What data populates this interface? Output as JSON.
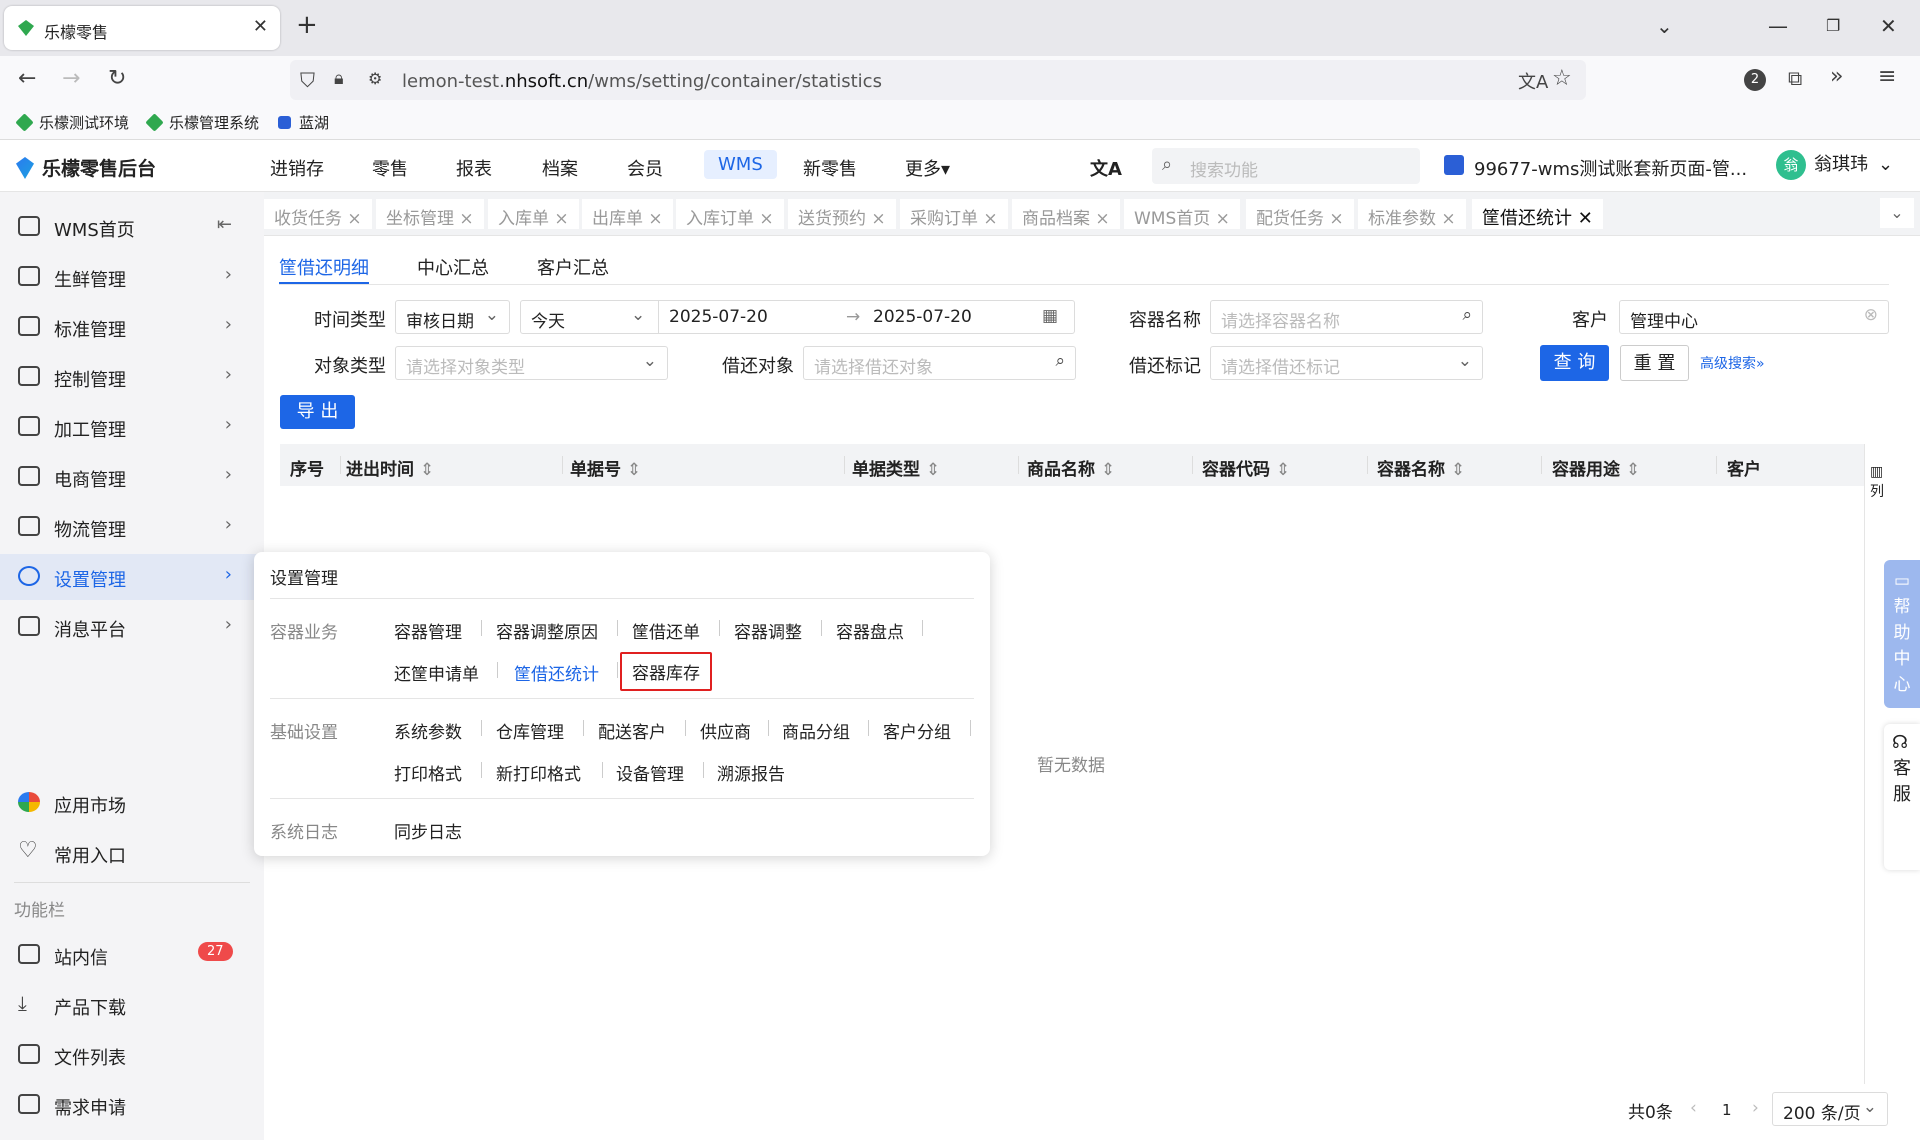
{
  "browser": {
    "tab_title": "乐檬零售",
    "url_prefix": "lemon-test.",
    "url_domain": "nhsoft.cn",
    "url_path": "/wms/setting/container/statistics",
    "ext_badge": "2",
    "bookmarks": [
      "乐檬测试环境",
      "乐檬管理系统",
      "蓝湖"
    ]
  },
  "header": {
    "logo": "乐檬零售后台",
    "nav": [
      "进销存",
      "零售",
      "报表",
      "档案",
      "会员",
      "WMS",
      "新零售",
      "更多▾"
    ],
    "search_placeholder": "搜索功能",
    "account": "99677-wms测试账套新页面-管...",
    "user_initial": "翁",
    "user_name": "翁琪玮"
  },
  "sidebar": {
    "items": [
      "WMS首页",
      "生鲜管理",
      "标准管理",
      "控制管理",
      "加工管理",
      "电商管理",
      "物流管理",
      "设置管理",
      "消息平台"
    ],
    "bottom": [
      "应用市场",
      "常用入口"
    ],
    "section": "功能栏",
    "tools": [
      "站内信",
      "产品下载",
      "文件列表",
      "需求申请"
    ],
    "badge": "27"
  },
  "page_tabs": [
    "收货任务",
    "坐标管理",
    "入库单",
    "出库单",
    "入库订单",
    "送货预约",
    "采购订单",
    "商品档案",
    "WMS首页",
    "配货任务",
    "标准参数",
    "筐借还统计"
  ],
  "subtabs": [
    "筐借还明细",
    "中心汇总",
    "客户汇总"
  ],
  "filters": {
    "time_type_label": "时间类型",
    "time_type": "审核日期",
    "period": "今天",
    "date_from": "2025-07-20",
    "date_to": "2025-07-20",
    "container_name_label": "容器名称",
    "container_name_ph": "请选择容器名称",
    "customer_label": "客户",
    "customer": "管理中心",
    "object_type_label": "对象类型",
    "object_type_ph": "请选择对象类型",
    "borrow_obj_label": "借还对象",
    "borrow_obj_ph": "请选择借还对象",
    "borrow_mark_label": "借还标记",
    "borrow_mark_ph": "请选择借还标记",
    "query": "查 询",
    "reset": "重 置",
    "advanced": "高级搜索»",
    "export": "导 出"
  },
  "table": {
    "columns": [
      "序号",
      "进出时间",
      "单据号",
      "单据类型",
      "商品名称",
      "容器代码",
      "容器名称",
      "容器用途",
      "客户"
    ],
    "col_setting": "列",
    "empty": "暂无数据"
  },
  "popup": {
    "title": "设置管理",
    "groups": [
      {
        "name": "容器业务",
        "links": [
          "容器管理",
          "容器调整原因",
          "筐借还单",
          "容器调整",
          "容器盘点",
          "还筐申请单",
          "筐借还统计",
          "容器库存"
        ]
      },
      {
        "name": "基础设置",
        "links": [
          "系统参数",
          "仓库管理",
          "配送客户",
          "供应商",
          "商品分组",
          "客户分组",
          "打印格式",
          "新打印格式",
          "设备管理",
          "溯源报告"
        ]
      },
      {
        "name": "系统日志",
        "links": [
          "同步日志"
        ]
      }
    ]
  },
  "side_float": {
    "help": "帮助中心",
    "service": "客服"
  },
  "pager": {
    "total": "共0条",
    "page": "1",
    "size": "200 条/页"
  },
  "colors": {
    "primary": "#1d66e6",
    "highlight_border": "#e02020",
    "badge": "#ef4a4a"
  }
}
